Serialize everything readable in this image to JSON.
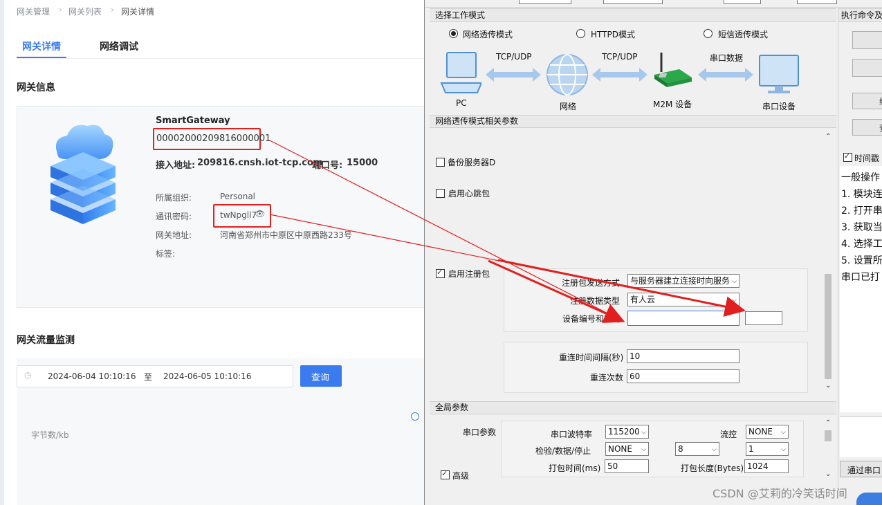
{
  "web": {
    "breadcrumb": [
      "网关管理",
      "网关列表",
      "网关详情"
    ],
    "tabs": [
      "网关详情",
      "网络调试"
    ],
    "info_title": "网关信息",
    "gateway_name": "SmartGateway",
    "gateway_sn": "00002000209816000001",
    "access_label": "接入地址:",
    "access_value": "209816.cnsh.iot-tcp.com",
    "port_label": "端口号:",
    "port_value": "15000",
    "org_label": "所属组织:",
    "org_value": "Personal",
    "pwd_label": "通讯密码:",
    "pwd_value": "twNpgll7",
    "addr_label": "网关地址:",
    "addr_value": "河南省郑州市中原区中原西路233号",
    "tag_label": "标签:",
    "traffic_title": "网关流量监测",
    "date_from": "2024-06-04 10:10:16",
    "date_to_sep": "至",
    "date_to": "2024-06-05 10:10:16",
    "query_btn": "查询",
    "y_axis": "字节数/kb",
    "accent": "#3a7bf0"
  },
  "app": {
    "mode_group": "选择工作模式",
    "modes": [
      "网络透传模式",
      "HTTPD模式",
      "短信透传模式"
    ],
    "selected_mode": 0,
    "diagram": {
      "pc": "PC",
      "net": "网络",
      "m2m": "M2M 设备",
      "serial_dev": "串口设备",
      "link1": "TCP/UDP",
      "link2": "TCP/UDP",
      "link3": "串口数据"
    },
    "params_group": "网络透传模式相关参数",
    "backup_server": "备份服务器D",
    "heartbeat": "启用心跳包",
    "register": "启用注册包",
    "reg_send_label": "注册包发送方式",
    "reg_send_value": "与服务器建立连接时向服务",
    "reg_type_label": "注册数据类型",
    "reg_type_value": "有人云",
    "dev_id_label": "设备编号和密码",
    "dev_id_value": "",
    "dev_pwd_value": "",
    "reconnect_interval_label": "重连时间间隔(秒)",
    "reconnect_interval_value": "10",
    "reconnect_count_label": "重连次数",
    "reconnect_count_value": "60",
    "global_group": "全局参数",
    "serial_params": "串口参数",
    "baud_label": "串口波特率",
    "baud_value": "115200",
    "flow_label": "流控",
    "flow_value": "NONE",
    "check_label": "检验/数据/停止",
    "parity_value": "NONE",
    "databits_value": "8",
    "stopbits_value": "1",
    "pack_time_label": "打包时间(ms)",
    "pack_time_value": "50",
    "pack_len_label": "打包长度(Bytes)",
    "pack_len_value": "1024",
    "advanced": "高级",
    "exec_group": "执行命令及",
    "timestamp": "时间戳",
    "log": [
      "一般操作",
      "1. 模块连",
      "2. 打开串",
      "3. 获取当",
      "4. 选择工",
      "5. 设置所",
      "串口已打"
    ],
    "serial_via": "通过串口"
  },
  "watermark": "CSDN @艾莉的冷笑话时间"
}
